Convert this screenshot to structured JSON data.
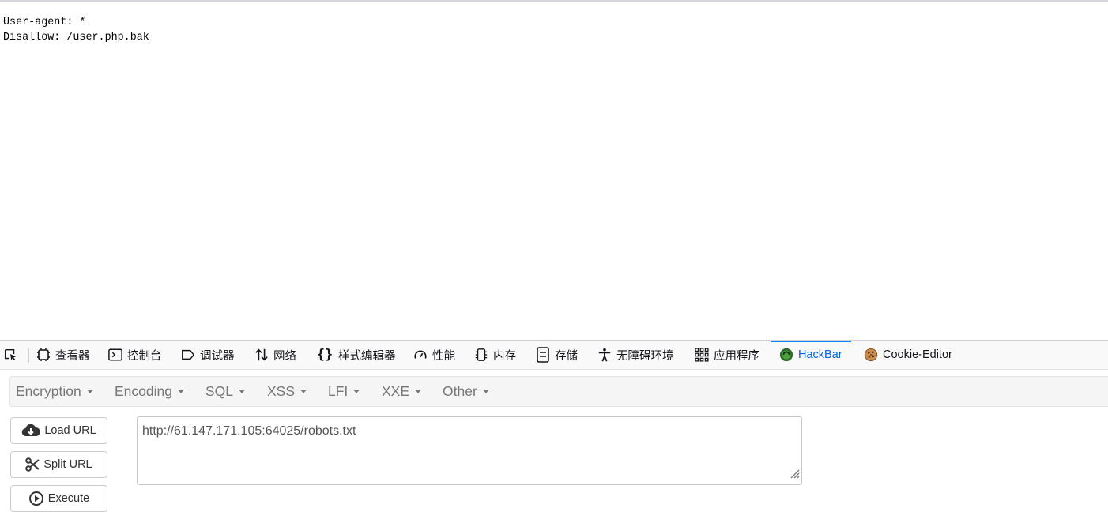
{
  "page": {
    "lines": [
      "User-agent: *",
      "Disallow: /user.php.bak"
    ]
  },
  "devtools": {
    "tabs": [
      {
        "label": "查看器",
        "icon": "inspector-icon"
      },
      {
        "label": "控制台",
        "icon": "console-icon"
      },
      {
        "label": "调试器",
        "icon": "debugger-icon"
      },
      {
        "label": "网络",
        "icon": "network-icon"
      },
      {
        "label": "样式编辑器",
        "icon": "style-editor-icon"
      },
      {
        "label": "性能",
        "icon": "performance-icon"
      },
      {
        "label": "内存",
        "icon": "memory-icon"
      },
      {
        "label": "存储",
        "icon": "storage-icon"
      },
      {
        "label": "无障碍环境",
        "icon": "accessibility-icon"
      },
      {
        "label": "应用程序",
        "icon": "application-icon"
      },
      {
        "label": "HackBar",
        "icon": "hackbar-icon",
        "active": true
      },
      {
        "label": "Cookie-Editor",
        "icon": "cookie-icon"
      }
    ],
    "active_color": "#0060df"
  },
  "hackbar": {
    "menus": [
      "Encryption",
      "Encoding",
      "SQL",
      "XSS",
      "LFI",
      "XXE",
      "Other"
    ],
    "buttons": {
      "load_url": "Load URL",
      "split_url": "Split URL",
      "execute": "Execute"
    },
    "url": "http://61.147.171.105:64025/robots.txt"
  }
}
